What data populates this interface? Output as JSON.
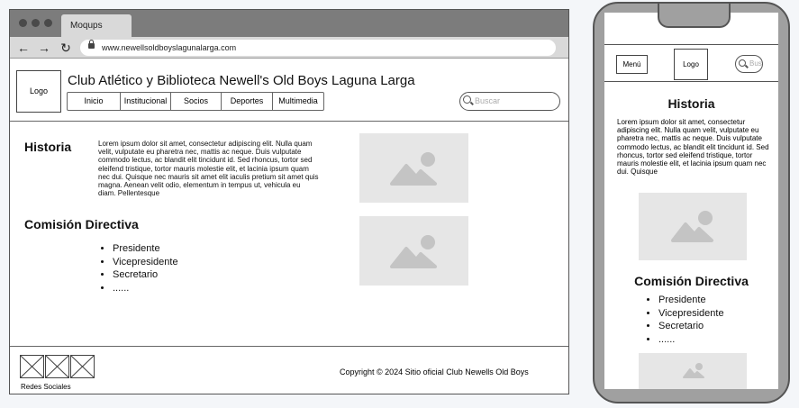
{
  "browser": {
    "tab_label": "Moqups",
    "url": "www.newellsoldboyslagunalarga.com",
    "back_glyph": "←",
    "forward_glyph": "→",
    "reload_glyph": "↻"
  },
  "site": {
    "logo_label": "Logo",
    "title": "Club Atlético y Biblioteca Newell's Old Boys Laguna Larga",
    "nav": [
      {
        "label": "Inicio"
      },
      {
        "label": "Institucional"
      },
      {
        "label": "Socios"
      },
      {
        "label": "Deportes"
      },
      {
        "label": "Multimedia"
      }
    ],
    "search_placeholder": "Buscar"
  },
  "content": {
    "historia_heading": "Historia",
    "historia_text": "Lorem ipsum dolor sit amet, consectetur adipiscing elit. Nulla quam velit, vulputate eu pharetra nec, mattis ac neque. Duis vulputate commodo lectus, ac blandit elit tincidunt id. Sed rhoncus, tortor sed eleifend tristique, tortor mauris molestie elit, et lacinia ipsum quam nec dui. Quisque nec mauris sit amet elit iaculis pretium sit amet quis magna. Aenean velit odio, elementum in tempus ut, vehicula eu diam. Pellentesque",
    "comision_heading": "Comisión Directiva",
    "comision_items": [
      "Presidente",
      "Vicepresidente",
      "Secretario",
      "......"
    ]
  },
  "footer": {
    "social_label": "Redes Sociales",
    "copyright": "Copyright © 2024 Sitio oficial Club Newells Old Boys"
  },
  "mobile": {
    "menu_label": "Menú",
    "logo_label": "Logo",
    "search_placeholder": "Buscar",
    "historia_heading": "Historia",
    "historia_text": "Lorem ipsum dolor sit amet, consectetur adipiscing elit. Nulla quam velit, vulputate eu pharetra nec, mattis ac neque. Duis vulputate commodo lectus, ac blandit elit tincidunt id. Sed rhoncus, tortor sed eleifend tristique, tortor mauris molestie elit, et lacinia ipsum quam nec dui. Quisque",
    "comision_heading": "Comisión Directiva",
    "comision_items": [
      "Presidente",
      "Vicepresidente",
      "Secretario",
      "......"
    ]
  },
  "colors": {
    "frame_dark": "#7c7c7c",
    "chrome_light": "#d9d9d9",
    "placeholder_bg": "#e6e6e6",
    "placeholder_icon": "#c4c4c4",
    "phone_body": "#a0a0a0"
  }
}
